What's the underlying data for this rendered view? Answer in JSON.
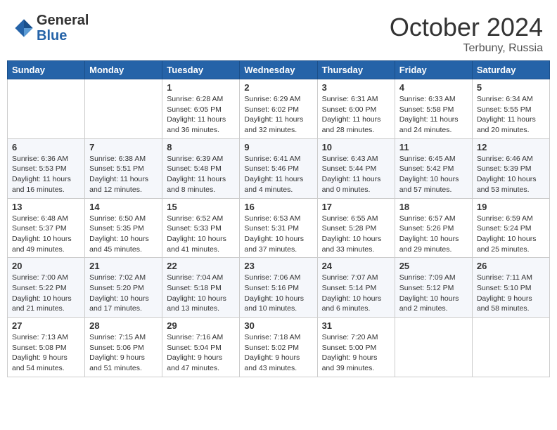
{
  "header": {
    "logo_general": "General",
    "logo_blue": "Blue",
    "month": "October 2024",
    "location": "Terbuny, Russia"
  },
  "days_of_week": [
    "Sunday",
    "Monday",
    "Tuesday",
    "Wednesday",
    "Thursday",
    "Friday",
    "Saturday"
  ],
  "weeks": [
    [
      {
        "day": "",
        "info": ""
      },
      {
        "day": "",
        "info": ""
      },
      {
        "day": "1",
        "info": "Sunrise: 6:28 AM\nSunset: 6:05 PM\nDaylight: 11 hours and 36 minutes."
      },
      {
        "day": "2",
        "info": "Sunrise: 6:29 AM\nSunset: 6:02 PM\nDaylight: 11 hours and 32 minutes."
      },
      {
        "day": "3",
        "info": "Sunrise: 6:31 AM\nSunset: 6:00 PM\nDaylight: 11 hours and 28 minutes."
      },
      {
        "day": "4",
        "info": "Sunrise: 6:33 AM\nSunset: 5:58 PM\nDaylight: 11 hours and 24 minutes."
      },
      {
        "day": "5",
        "info": "Sunrise: 6:34 AM\nSunset: 5:55 PM\nDaylight: 11 hours and 20 minutes."
      }
    ],
    [
      {
        "day": "6",
        "info": "Sunrise: 6:36 AM\nSunset: 5:53 PM\nDaylight: 11 hours and 16 minutes."
      },
      {
        "day": "7",
        "info": "Sunrise: 6:38 AM\nSunset: 5:51 PM\nDaylight: 11 hours and 12 minutes."
      },
      {
        "day": "8",
        "info": "Sunrise: 6:39 AM\nSunset: 5:48 PM\nDaylight: 11 hours and 8 minutes."
      },
      {
        "day": "9",
        "info": "Sunrise: 6:41 AM\nSunset: 5:46 PM\nDaylight: 11 hours and 4 minutes."
      },
      {
        "day": "10",
        "info": "Sunrise: 6:43 AM\nSunset: 5:44 PM\nDaylight: 11 hours and 0 minutes."
      },
      {
        "day": "11",
        "info": "Sunrise: 6:45 AM\nSunset: 5:42 PM\nDaylight: 10 hours and 57 minutes."
      },
      {
        "day": "12",
        "info": "Sunrise: 6:46 AM\nSunset: 5:39 PM\nDaylight: 10 hours and 53 minutes."
      }
    ],
    [
      {
        "day": "13",
        "info": "Sunrise: 6:48 AM\nSunset: 5:37 PM\nDaylight: 10 hours and 49 minutes."
      },
      {
        "day": "14",
        "info": "Sunrise: 6:50 AM\nSunset: 5:35 PM\nDaylight: 10 hours and 45 minutes."
      },
      {
        "day": "15",
        "info": "Sunrise: 6:52 AM\nSunset: 5:33 PM\nDaylight: 10 hours and 41 minutes."
      },
      {
        "day": "16",
        "info": "Sunrise: 6:53 AM\nSunset: 5:31 PM\nDaylight: 10 hours and 37 minutes."
      },
      {
        "day": "17",
        "info": "Sunrise: 6:55 AM\nSunset: 5:28 PM\nDaylight: 10 hours and 33 minutes."
      },
      {
        "day": "18",
        "info": "Sunrise: 6:57 AM\nSunset: 5:26 PM\nDaylight: 10 hours and 29 minutes."
      },
      {
        "day": "19",
        "info": "Sunrise: 6:59 AM\nSunset: 5:24 PM\nDaylight: 10 hours and 25 minutes."
      }
    ],
    [
      {
        "day": "20",
        "info": "Sunrise: 7:00 AM\nSunset: 5:22 PM\nDaylight: 10 hours and 21 minutes."
      },
      {
        "day": "21",
        "info": "Sunrise: 7:02 AM\nSunset: 5:20 PM\nDaylight: 10 hours and 17 minutes."
      },
      {
        "day": "22",
        "info": "Sunrise: 7:04 AM\nSunset: 5:18 PM\nDaylight: 10 hours and 13 minutes."
      },
      {
        "day": "23",
        "info": "Sunrise: 7:06 AM\nSunset: 5:16 PM\nDaylight: 10 hours and 10 minutes."
      },
      {
        "day": "24",
        "info": "Sunrise: 7:07 AM\nSunset: 5:14 PM\nDaylight: 10 hours and 6 minutes."
      },
      {
        "day": "25",
        "info": "Sunrise: 7:09 AM\nSunset: 5:12 PM\nDaylight: 10 hours and 2 minutes."
      },
      {
        "day": "26",
        "info": "Sunrise: 7:11 AM\nSunset: 5:10 PM\nDaylight: 9 hours and 58 minutes."
      }
    ],
    [
      {
        "day": "27",
        "info": "Sunrise: 7:13 AM\nSunset: 5:08 PM\nDaylight: 9 hours and 54 minutes."
      },
      {
        "day": "28",
        "info": "Sunrise: 7:15 AM\nSunset: 5:06 PM\nDaylight: 9 hours and 51 minutes."
      },
      {
        "day": "29",
        "info": "Sunrise: 7:16 AM\nSunset: 5:04 PM\nDaylight: 9 hours and 47 minutes."
      },
      {
        "day": "30",
        "info": "Sunrise: 7:18 AM\nSunset: 5:02 PM\nDaylight: 9 hours and 43 minutes."
      },
      {
        "day": "31",
        "info": "Sunrise: 7:20 AM\nSunset: 5:00 PM\nDaylight: 9 hours and 39 minutes."
      },
      {
        "day": "",
        "info": ""
      },
      {
        "day": "",
        "info": ""
      }
    ]
  ]
}
